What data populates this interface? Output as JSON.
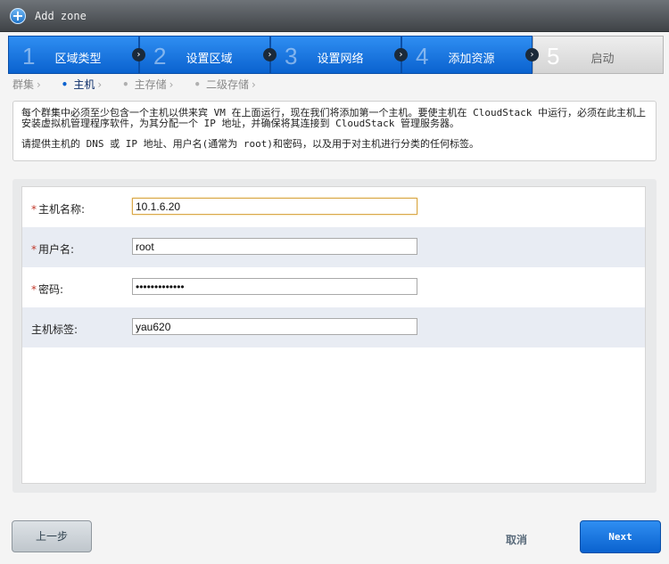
{
  "window": {
    "title": "Add zone"
  },
  "steps": [
    {
      "num": "1",
      "label": "区域类型"
    },
    {
      "num": "2",
      "label": "设置区域"
    },
    {
      "num": "3",
      "label": "设置网络"
    },
    {
      "num": "4",
      "label": "添加资源"
    },
    {
      "num": "5",
      "label": "启动"
    }
  ],
  "substeps": [
    {
      "label": "群集"
    },
    {
      "label": "主机"
    },
    {
      "label": "主存储"
    },
    {
      "label": "二级存储"
    }
  ],
  "info": {
    "line1": "每个群集中必须至少包含一个主机以供来宾 VM 在上面运行，现在我们将添加第一个主机。要使主机在 CloudStack 中运行，必须在此主机上安装虚拟机管理程序软件，为其分配一个 IP 地址，并确保将其连接到 CloudStack 管理服务器。",
    "line2": "请提供主机的 DNS 或 IP 地址、用户名(通常为 root)和密码，以及用于对主机进行分类的任何标签。"
  },
  "form": {
    "required_mark": "*",
    "host_name": {
      "label": "主机名称:",
      "value": "10.1.6.20"
    },
    "username": {
      "label": "用户名:",
      "value": "root"
    },
    "password": {
      "label": "密码:",
      "value": "•••••••••••••"
    },
    "host_tags": {
      "label": "主机标签:",
      "value": "yau620"
    }
  },
  "buttons": {
    "prev": "上一步",
    "cancel": "取消",
    "next": "Next"
  },
  "colors": {
    "accent": "#0a62cf",
    "required": "#c0392b"
  }
}
